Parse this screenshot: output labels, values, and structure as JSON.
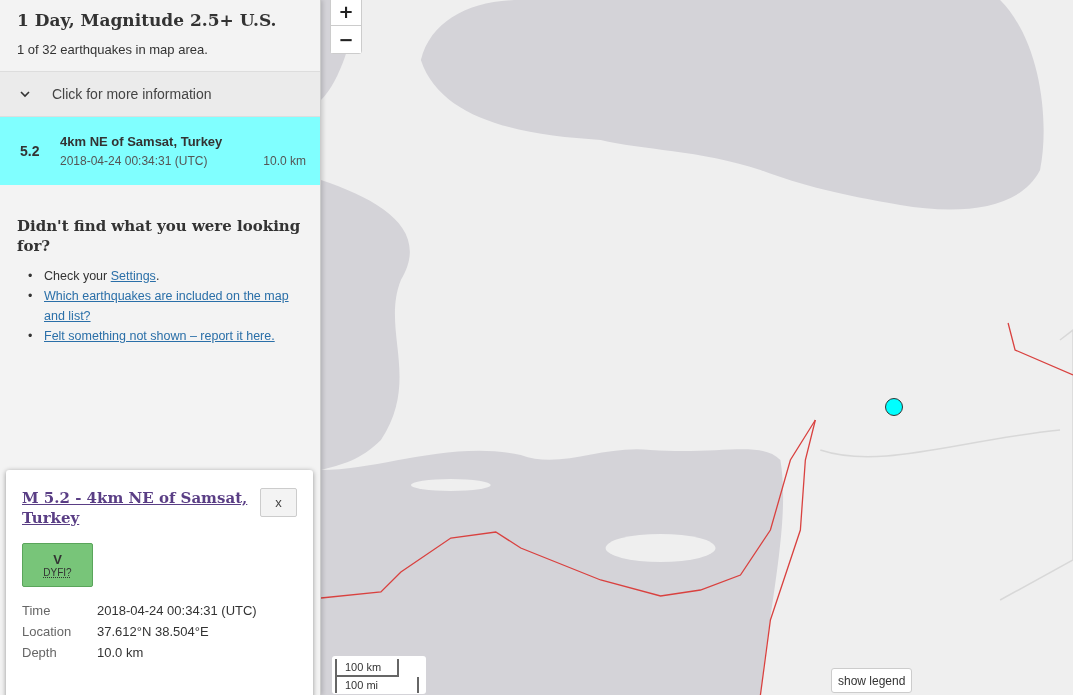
{
  "sidebar": {
    "title": "1 Day, Magnitude 2.5+ U.S.",
    "count": "1 of 32 earthquakes in map area.",
    "info_toggle": {
      "label": "Click for more information",
      "expanded": false
    },
    "earthquakes": [
      {
        "magnitude": "5.2",
        "place": "4km NE of Samsat, Turkey",
        "time": "2018-04-24 00:34:31 (UTC)",
        "depth": "10.0 km",
        "selected": true
      }
    ],
    "help": {
      "heading": "Didn't find what you were looking for?",
      "items": [
        {
          "bullet": "•",
          "prefix": "Check your ",
          "link": "Settings",
          "suffix": "."
        },
        {
          "bullet": "•",
          "link": "Which earthquakes are included on the map and list?"
        },
        {
          "bullet": "•",
          "link": "Felt something not shown – report it here."
        }
      ]
    }
  },
  "map": {
    "zoom_in": "+",
    "zoom_out": "−",
    "scale": [
      "100 km",
      "100 mi"
    ],
    "legend_button": "show legend"
  },
  "popup": {
    "title": "M 5.2 - 4km NE of Samsat, Turkey",
    "close": "x",
    "dyfi": {
      "intensity": "V",
      "label": "DYFI?"
    },
    "details": [
      {
        "label": "Time",
        "value": "2018-04-24 00:34:31 (UTC)"
      },
      {
        "label": "Location",
        "value": "37.612°N 38.504°E"
      },
      {
        "label": "Depth",
        "value": "10.0 km"
      }
    ]
  }
}
